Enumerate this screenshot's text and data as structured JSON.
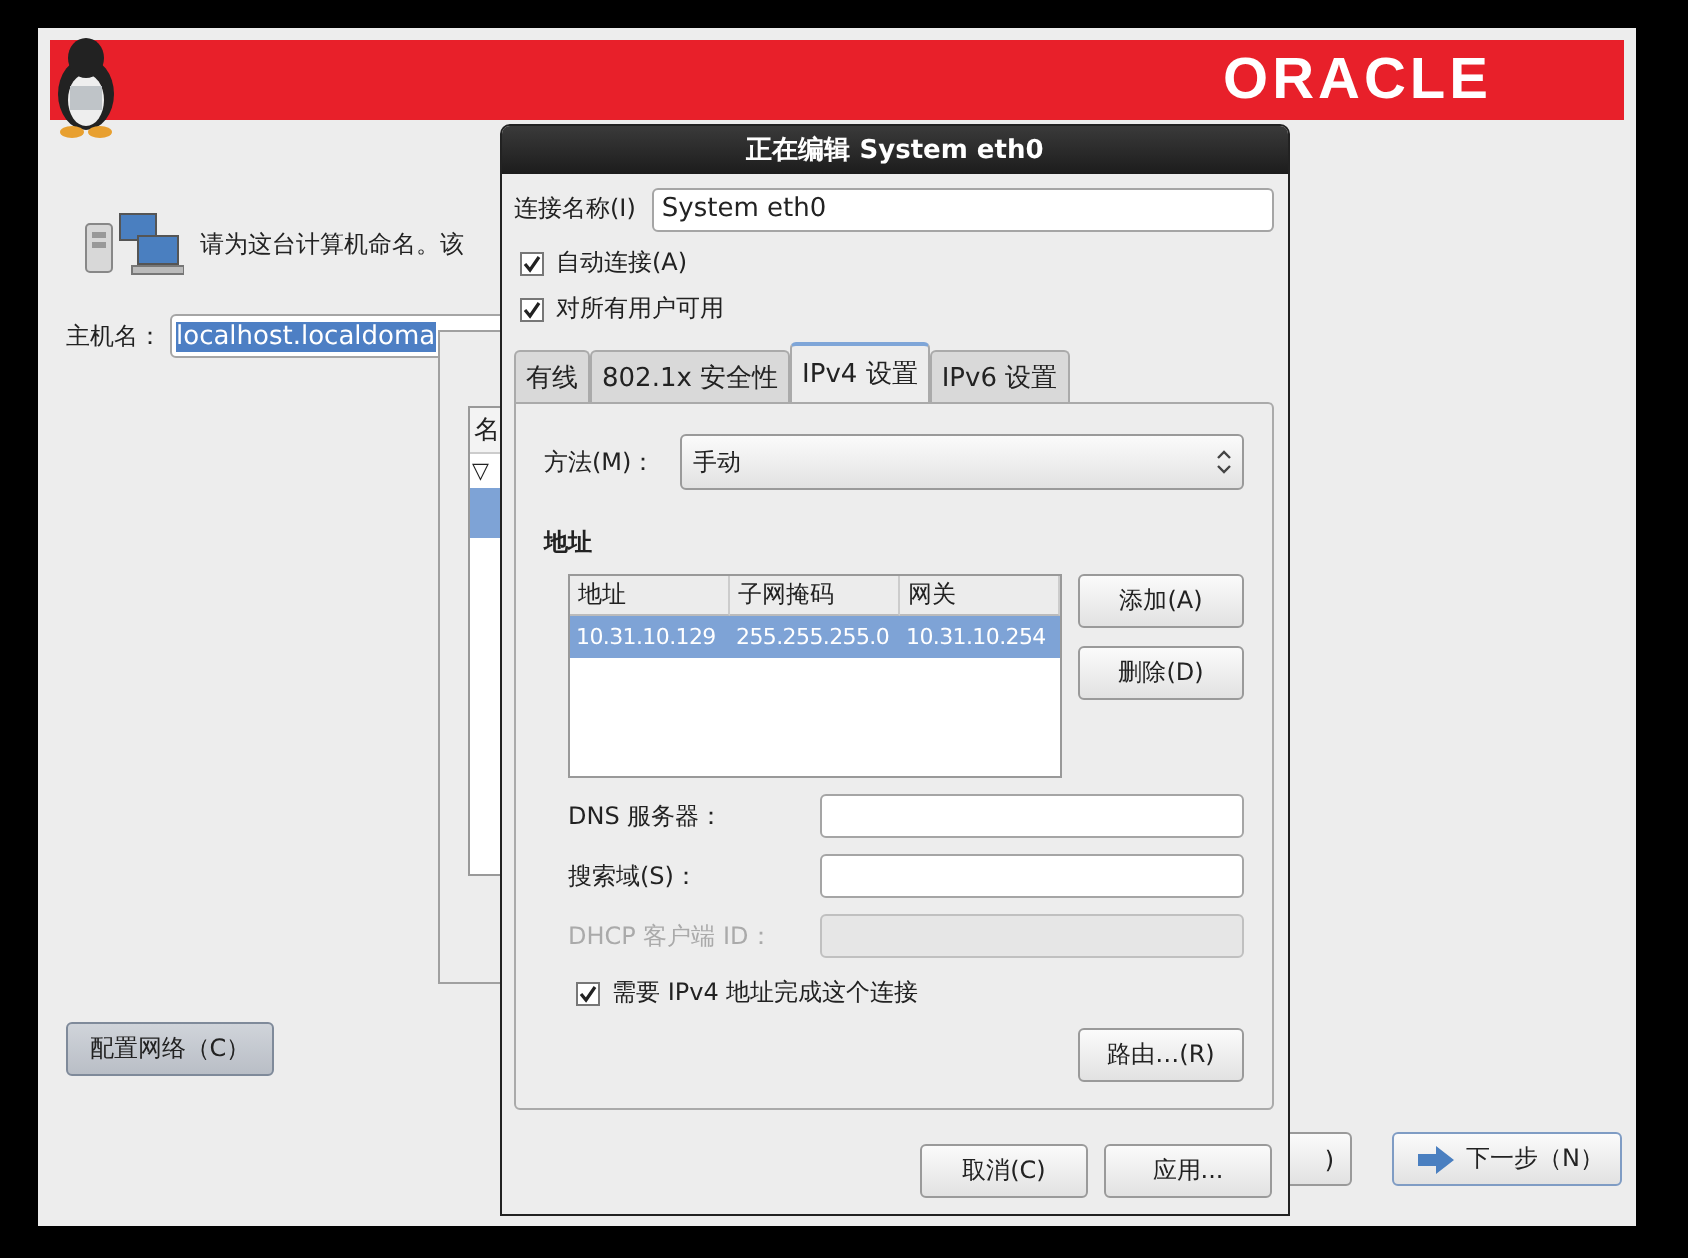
{
  "installer": {
    "banner": {
      "logo": "ORACLE"
    },
    "prompt": "请为这台计算机命名。该",
    "hostname": {
      "label": "主机名：",
      "value": "localhost.localdoma",
      "text_selected": true
    },
    "configure_button": "配置网络（C）",
    "back_button": ")",
    "next_button": "下一步（N）"
  },
  "network_window": {
    "list_header": "名",
    "rows": [
      {
        "text": "▽",
        "selected": false
      },
      {
        "selected": true
      }
    ]
  },
  "dialog": {
    "title": "正在编辑 System eth0",
    "connection_name": {
      "label": "连接名称(I)",
      "value": "System eth0"
    },
    "options": [
      {
        "label": "自动连接(A)",
        "checked": true
      },
      {
        "label": "对所有用户可用",
        "checked": true
      }
    ],
    "tabs": [
      {
        "label": "有线",
        "selected": false
      },
      {
        "label": "802.1x 安全性",
        "selected": false
      },
      {
        "label": "IPv4 设置",
        "selected": true
      },
      {
        "label": "IPv6 设置",
        "selected": false
      }
    ],
    "method": {
      "label": "方法(M)：",
      "value": "手动"
    },
    "addresses": {
      "heading": "地址",
      "columns": [
        "地址",
        "子网掩码",
        "网关"
      ],
      "rows": [
        {
          "cells": [
            "10.31.10.129",
            "255.255.255.0",
            "10.31.10.254"
          ],
          "selected": true
        }
      ]
    },
    "address_buttons": [
      "添加(A)",
      "删除(D)"
    ],
    "fields": [
      {
        "label": "DNS 服务器：",
        "disabled": false
      },
      {
        "label": "搜索域(S)：",
        "disabled": false
      },
      {
        "label": "DHCP 客户端 ID：",
        "disabled": true
      }
    ],
    "require_ipv4": {
      "label": "需要 IPv4 地址完成这个连接",
      "checked": true
    },
    "routes_button": "路由…(R)",
    "buttons": [
      "取消(C)",
      "应用..."
    ]
  }
}
